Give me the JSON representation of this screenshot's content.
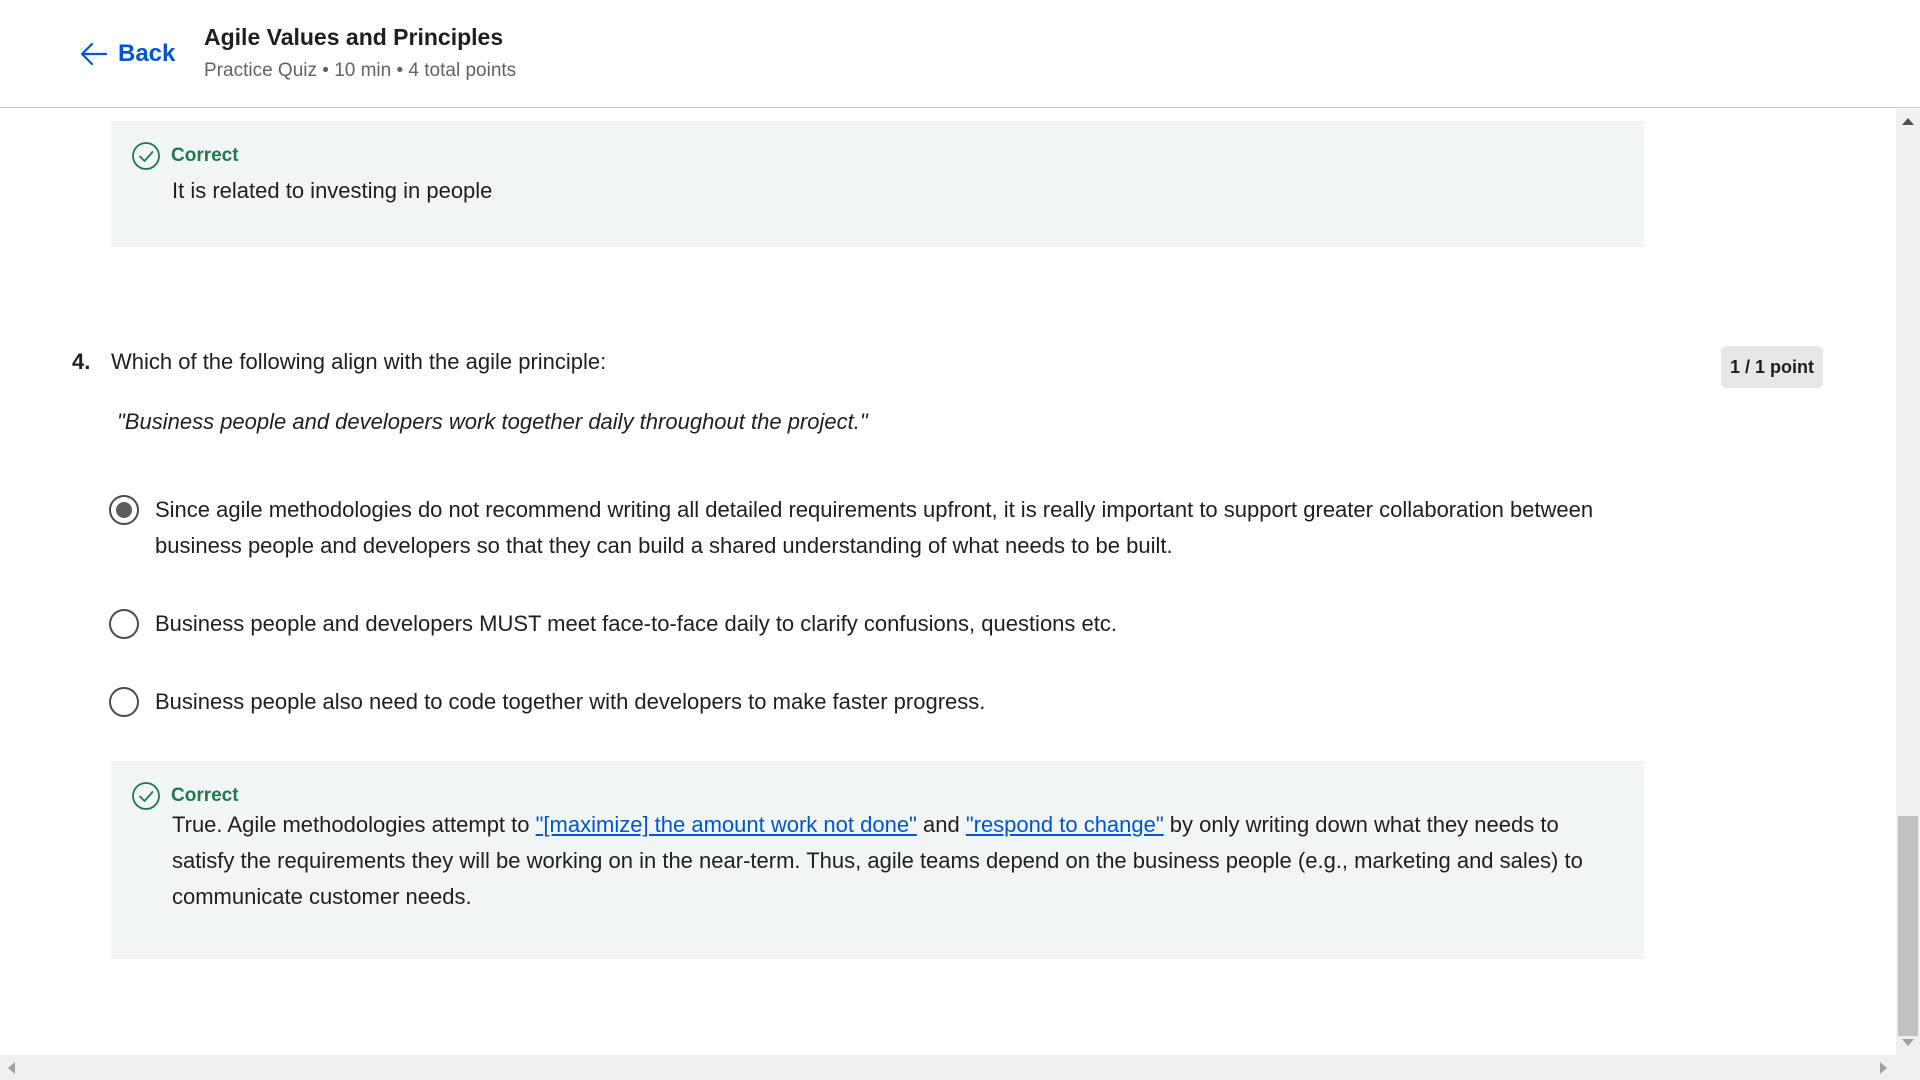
{
  "header": {
    "back_label": "Back",
    "title": "Agile Values and Principles",
    "subtitle": "Practice Quiz • 10 min • 4 total points"
  },
  "prev_feedback": {
    "label": "Correct",
    "text": "It is related to investing in people"
  },
  "question": {
    "number": "4.",
    "text": "Which of the following align with the agile principle:",
    "quote": "\"Business people and developers work together daily throughout the project.\"",
    "points": "1 / 1 point",
    "options": [
      {
        "text": "Since agile methodologies do not recommend writing all detailed requirements upfront, it is really important to support greater collaboration between business people and developers so that they can build a shared understanding of what needs to be built.",
        "selected": true
      },
      {
        "text": "Business people and developers MUST meet face-to-face daily to clarify confusions, questions etc.",
        "selected": false
      },
      {
        "text": "Business people also need to code together with developers to make faster progress.",
        "selected": false
      }
    ],
    "feedback": {
      "label": "Correct",
      "prefix": "True.  Agile methodologies attempt to ",
      "link1": "\"[maximize] the amount work not done\"",
      "middle": " and ",
      "link2": "\"respond to change\"",
      "suffix": " by only writing down what they needs to satisfy the requirements they will be working on in the near-term.  Thus, agile teams depend on the business people (e.g., marketing and sales) to communicate customer needs."
    }
  },
  "colors": {
    "accent": "#0056d2",
    "correct": "#1e7b4c",
    "feedback_bg": "#f2f5f5"
  },
  "icons": {
    "back": "arrow-left-icon",
    "correct": "check-circle-icon"
  }
}
